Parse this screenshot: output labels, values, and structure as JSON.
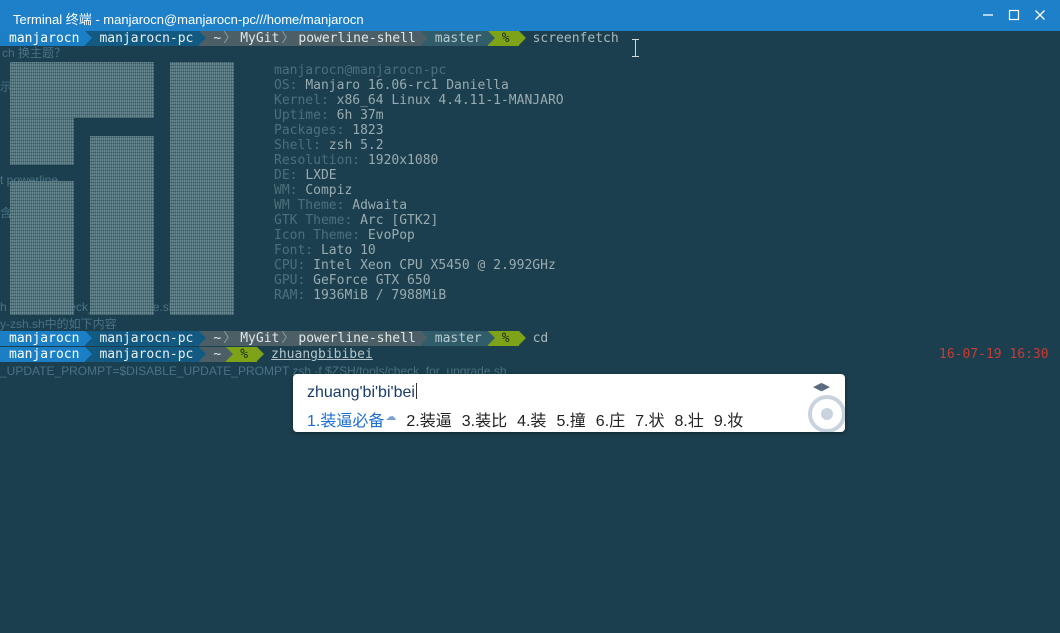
{
  "window": {
    "title": "Terminal 终端 - manjarocn@manjarocn-pc///home/manjarocn",
    "controls": [
      "minimize-icon",
      "maximize-icon",
      "close-icon"
    ]
  },
  "prompts": [
    {
      "user": "manjarocn",
      "host": "manjarocn-pc",
      "path": [
        "~",
        "MyGit",
        "powerline-shell"
      ],
      "branch": "master",
      "status": "%",
      "command": "screenfetch"
    },
    {
      "user": "manjarocn",
      "host": "manjarocn-pc",
      "path": [
        "~",
        "MyGit",
        "powerline-shell"
      ],
      "branch": "master",
      "status": "%",
      "command": "cd"
    },
    {
      "user": "manjarocn",
      "host": "manjarocn-pc",
      "path": [
        "~"
      ],
      "status": "%",
      "command": "zhuangbibibei",
      "time": "16-07-19 16:30"
    }
  ],
  "sysinfo": {
    "user_host": "manjarocn@manjarocn-pc",
    "rows": [
      {
        "key": "OS: ",
        "value": "Manjaro 16.06-rc1 Daniella"
      },
      {
        "key": "Kernel: ",
        "value": "x86_64 Linux 4.4.11-1-MANJARO"
      },
      {
        "key": "Uptime: ",
        "value": "6h 37m"
      },
      {
        "key": "Packages: ",
        "value": "1823"
      },
      {
        "key": "Shell: ",
        "value": "zsh 5.2"
      },
      {
        "key": "Resolution: ",
        "value": "1920x1080"
      },
      {
        "key": "DE: ",
        "value": "LXDE"
      },
      {
        "key": "WM: ",
        "value": "Compiz"
      },
      {
        "key": "WM Theme: ",
        "value": "Adwaita"
      },
      {
        "key": "GTK Theme: ",
        "value": "Arc [GTK2]"
      },
      {
        "key": "Icon Theme: ",
        "value": "EvoPop"
      },
      {
        "key": "Font: ",
        "value": "Lato 10"
      },
      {
        "key": "CPU: ",
        "value": "Intel Xeon CPU X5450 @ 2.992GHz"
      },
      {
        "key": "GPU: ",
        "value": "GeForce GTX 650"
      },
      {
        "key": "RAM: ",
        "value": "1936MiB / 7988MiB"
      }
    ]
  },
  "background_bleed": [
    "ch 换主题？",
    "示",
    "t powerline",
    "含",
    "h                 aro                  -zsh          check_for_upgrade.sh",
    "y-zsh.sh中的如下内容",
    "_UPDATE_PROMPT=$DISABLE_UPDATE_PROMPT zsh -f $ZSH/tools/check_for_upgrade.sh"
  ],
  "ime": {
    "pinyin": "zhuang'bi'bi'bei",
    "candidates": [
      "1.装逼必备",
      "2.装逼",
      "3.装比",
      "4.装",
      "5.撞",
      "6.庄",
      "7.状",
      "8.壮",
      "9.妆"
    ],
    "nav_icons": [
      "prev-page-icon",
      "next-page-icon"
    ]
  },
  "colors": {
    "title_bar": "#1e80c8",
    "terminal_bg": "#1b3f4e",
    "user_segment": "#1a7fc5",
    "host_segment": "#135a83",
    "path_segment": "#4c5f66",
    "branch_segment": "#315c6a",
    "status_segment": "#7ea218",
    "timestamp": "#c83b33"
  }
}
